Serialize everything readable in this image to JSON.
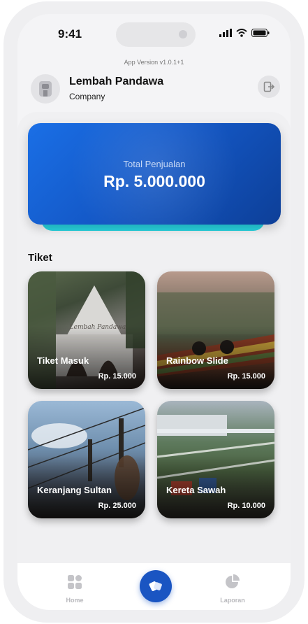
{
  "status_bar": {
    "time": "9:41"
  },
  "app_version": "App Version v1.0.1+1",
  "header": {
    "company_name": "Lembah Pandawa",
    "company_type": "Company"
  },
  "sales": {
    "label": "Total Penjualan",
    "value": "Rp. 5.000.000"
  },
  "tickets_section": {
    "title": "Tiket",
    "items": [
      {
        "name": "Tiket Masuk",
        "price": "Rp. 15.000",
        "overlay_text": "Lembah Pandawa"
      },
      {
        "name": "Rainbow Slide",
        "price": "Rp. 15.000"
      },
      {
        "name": "Keranjang Sultan",
        "price": "Rp. 25.000"
      },
      {
        "name": "Kereta Sawah",
        "price": "Rp. 10.000"
      }
    ]
  },
  "bottom_nav": {
    "home": "Home",
    "report": "Laporan"
  },
  "colors": {
    "primary": "#1a55c2",
    "accent": "#27d3df",
    "background": "#f0f0f2"
  },
  "icons": [
    "signal-icon",
    "wifi-icon",
    "battery-icon",
    "company-logo-icon",
    "logout-icon",
    "home-grid-icon",
    "scan-icon",
    "pie-chart-icon"
  ]
}
